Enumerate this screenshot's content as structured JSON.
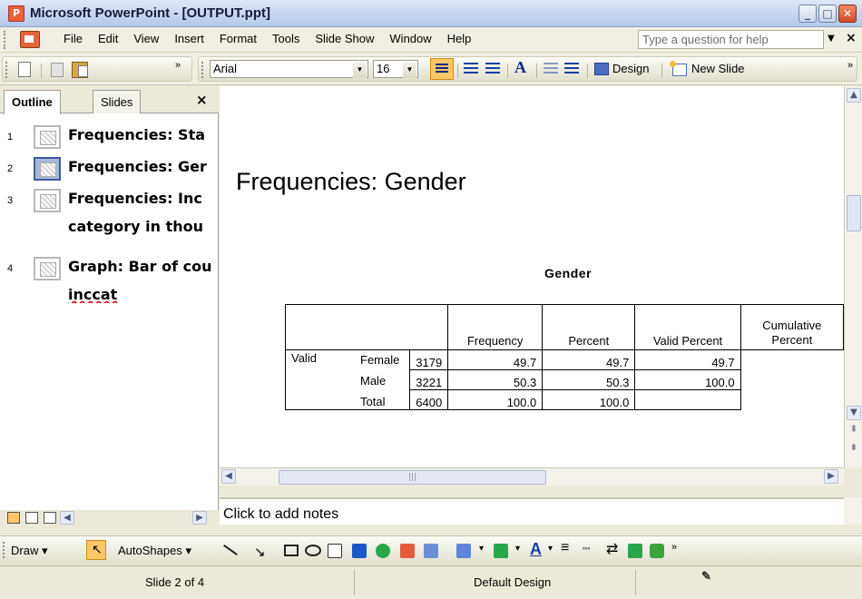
{
  "window": {
    "title": "Microsoft PowerPoint - [OUTPUT.ppt]",
    "icon": "powerpoint-icon"
  },
  "menu": {
    "items": [
      "File",
      "Edit",
      "View",
      "Insert",
      "Format",
      "Tools",
      "Slide Show",
      "Window",
      "Help"
    ],
    "help_placeholder": "Type a question for help"
  },
  "formatting": {
    "font": "Arial",
    "size": "16",
    "design_label": "Design",
    "new_slide_label": "New Slide"
  },
  "left_pane": {
    "tabs": [
      "Outline",
      "Slides"
    ],
    "items": [
      {
        "num": "1",
        "text": "Frequencies: Sta",
        "selected": false
      },
      {
        "num": "2",
        "text": "Frequencies: Ger",
        "selected": true
      },
      {
        "num": "3",
        "text": "Frequencies: Inc",
        "text2": "category in thou",
        "selected": false
      },
      {
        "num": "4",
        "text": "Graph: Bar of cou",
        "text2": "inccat",
        "selected": false
      }
    ]
  },
  "slide": {
    "title": "Frequencies: Gender",
    "table_caption": "Gender",
    "headers": [
      "Frequency",
      "Percent",
      "Valid Percent",
      "Cumulative Percent"
    ],
    "header_cumulative_line1": "Cumulative",
    "header_cumulative_line2": "Percent",
    "group_label": "Valid",
    "rows": [
      {
        "label": "Female",
        "frequency": "3179",
        "percent": "49.7",
        "valid_percent": "49.7",
        "cumulative": "49.7"
      },
      {
        "label": "Male",
        "frequency": "3221",
        "percent": "50.3",
        "valid_percent": "50.3",
        "cumulative": "100.0"
      },
      {
        "label": "Total",
        "frequency": "6400",
        "percent": "100.0",
        "valid_percent": "100.0",
        "cumulative": ""
      }
    ]
  },
  "notes": {
    "placeholder": "Click to add notes"
  },
  "drawing": {
    "draw_label": "Draw",
    "autoshapes_label": "AutoShapes"
  },
  "status": {
    "slide_indicator": "Slide 2 of 4",
    "design": "Default Design"
  },
  "colors": {
    "accent_selected": "#fcc76a",
    "title_bar": "#c4d4ee"
  }
}
